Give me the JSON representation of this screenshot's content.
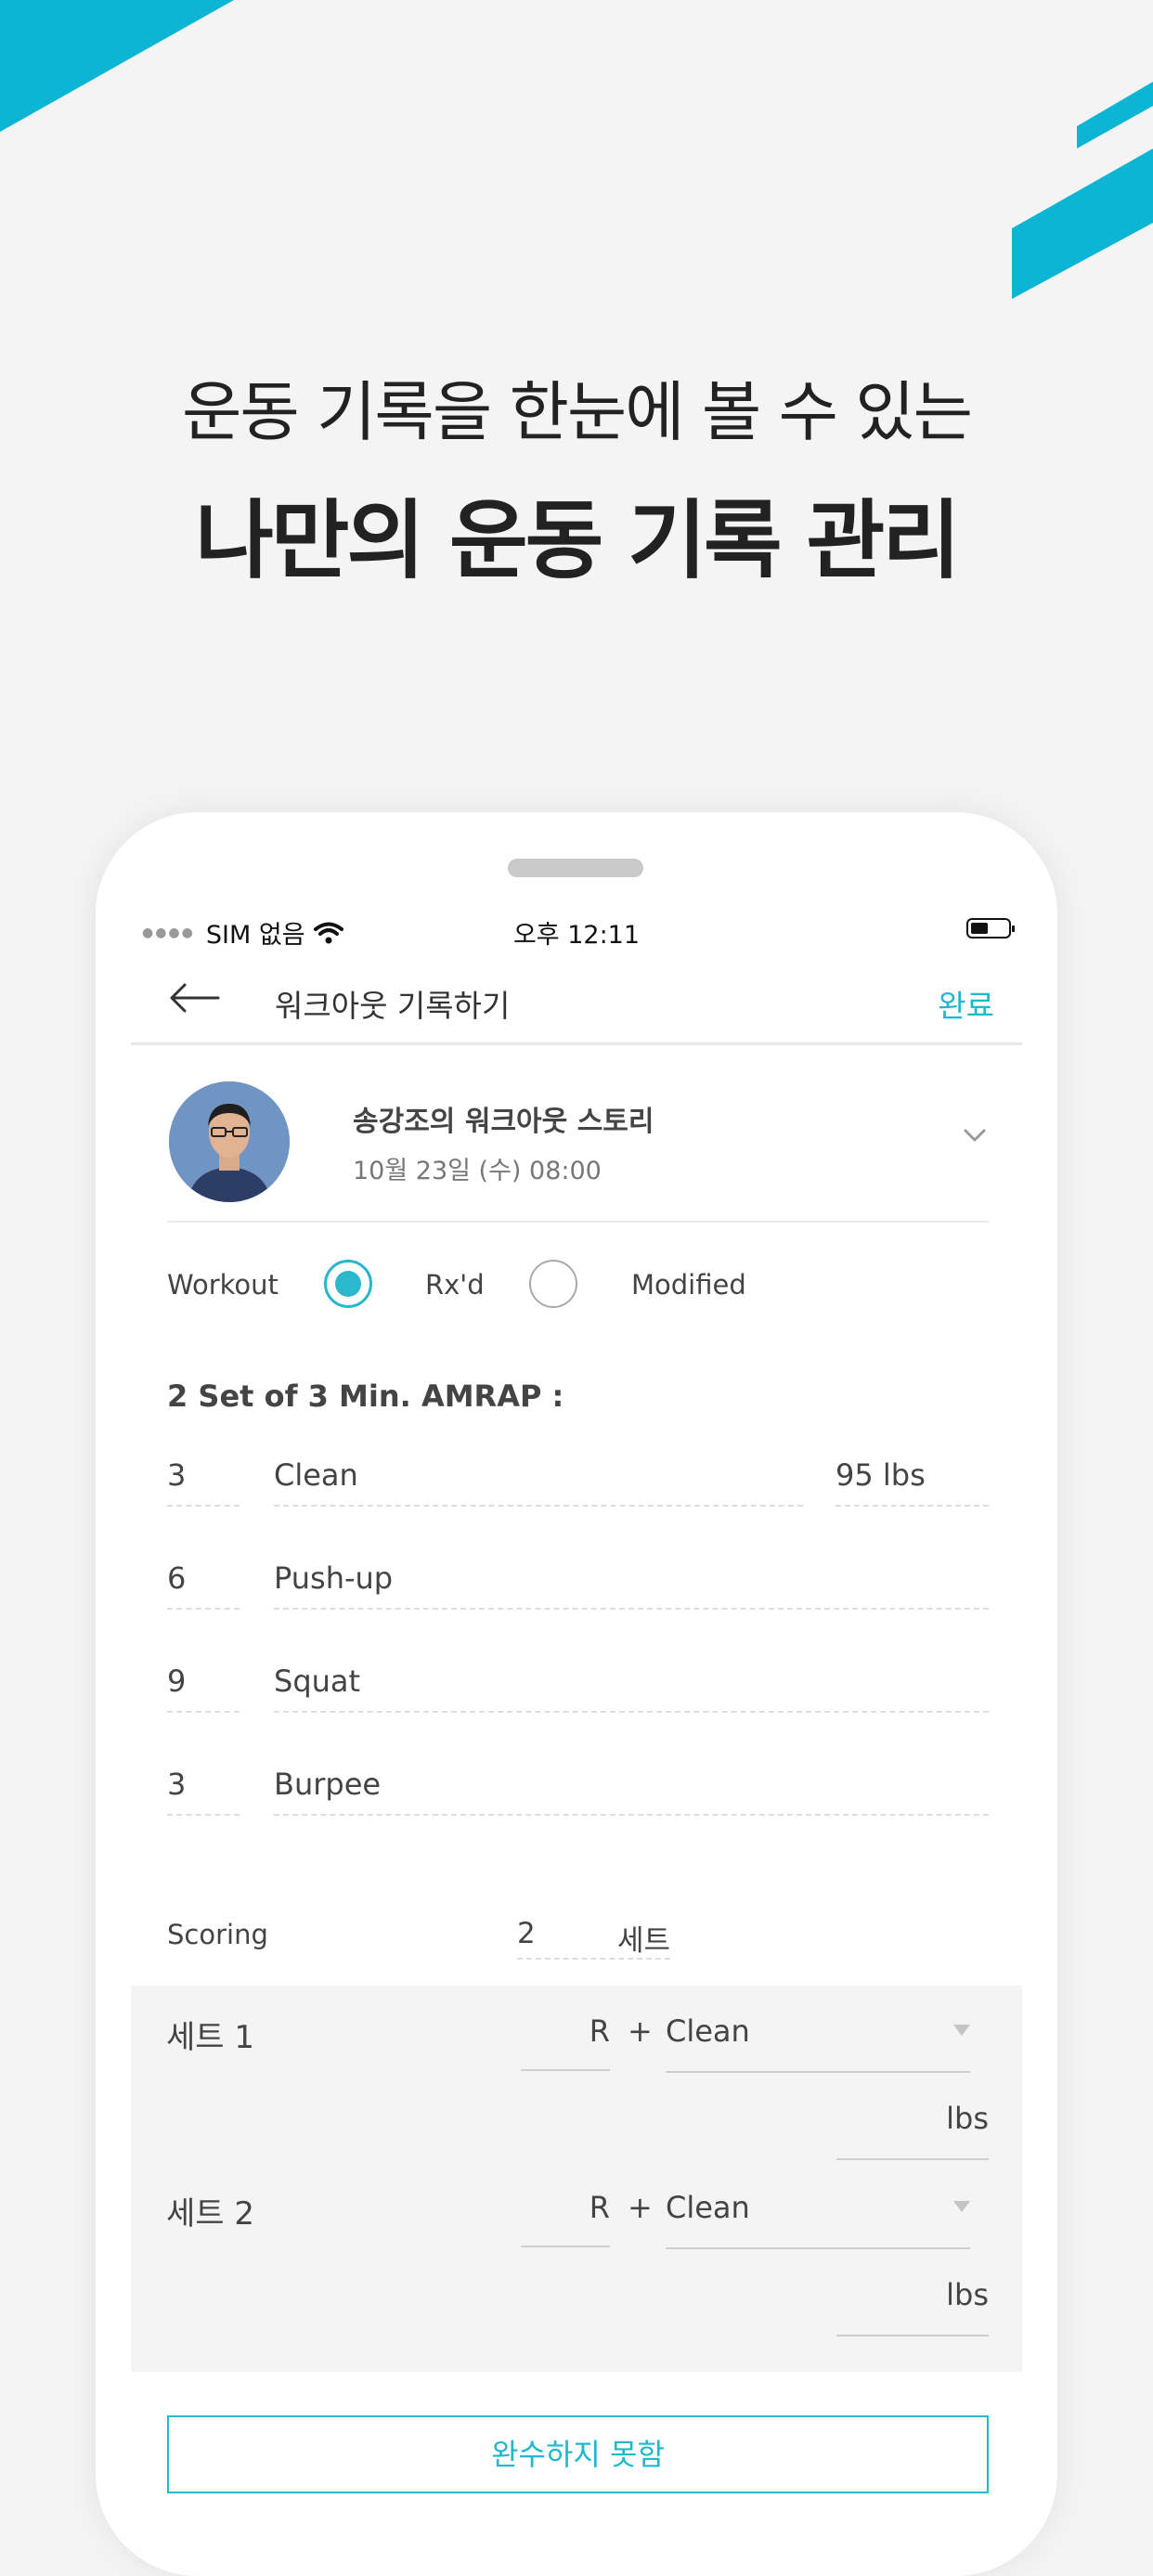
{
  "promo": {
    "subtitle": "운동 기록을 한눈에 볼 수 있는",
    "title": "나만의 운동 기록 관리",
    "accent_color": "#0bb5d3"
  },
  "status_bar": {
    "carrier": "SIM 없음",
    "time": "오후 12:11",
    "icons": [
      "wifi-icon",
      "battery-icon"
    ]
  },
  "navbar": {
    "back_icon": "arrow-left-icon",
    "title": "워크아웃 기록하기",
    "done_label": "완료"
  },
  "story": {
    "name": "송강조의 워크아웃 스토리",
    "date": "10월 23일 (수) 08:00",
    "expand_icon": "chevron-down-icon"
  },
  "workout_type": {
    "label": "Workout",
    "options": [
      {
        "label": "Rx'd",
        "selected": true
      },
      {
        "label": "Modified",
        "selected": false
      }
    ]
  },
  "wod": {
    "title": "2 Set of 3 Min. AMRAP :",
    "exercises": [
      {
        "reps": "3",
        "name": "Clean",
        "weight": "95",
        "unit": "lbs"
      },
      {
        "reps": "6",
        "name": "Push-up"
      },
      {
        "reps": "9",
        "name": "Squat"
      },
      {
        "reps": "3",
        "name": "Burpee"
      }
    ]
  },
  "scoring": {
    "label": "Scoring",
    "value": "2",
    "unit": "세트"
  },
  "sets": [
    {
      "label": "세트 1",
      "rounds_unit": "R",
      "plus": "+",
      "movement": "Clean",
      "weight_unit": "lbs"
    },
    {
      "label": "세트 2",
      "rounds_unit": "R",
      "plus": "+",
      "movement": "Clean",
      "weight_unit": "lbs"
    }
  ],
  "fail_button": "완수하지 못함"
}
